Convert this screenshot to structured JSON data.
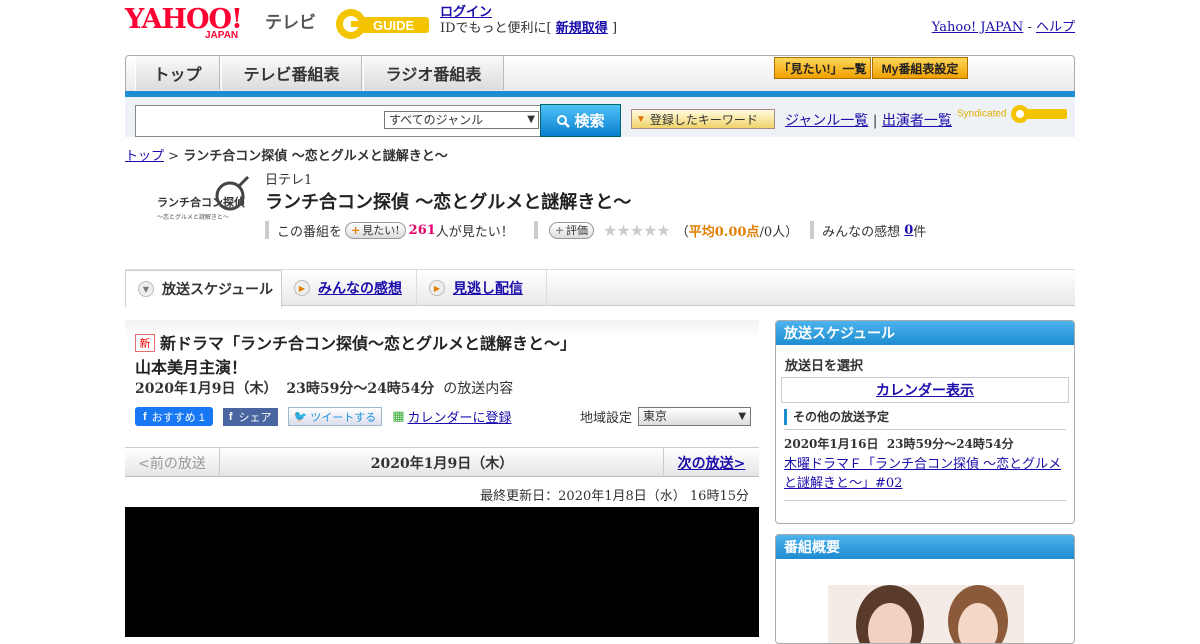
{
  "header": {
    "yahoo_logo": "YAHOO!",
    "yahoo_sub": "JAPAN",
    "tv_label": "テレビ",
    "gguide_logo": "GUIDE",
    "login_link": "ログイン",
    "login_text_pre": "IDでもっと便利に[",
    "signup_link": "新規取得",
    "login_text_post": "]",
    "yahoo_japan_link": "Yahoo! JAPAN",
    "dash": " - ",
    "help_link": "ヘルプ"
  },
  "nav": {
    "tabs": [
      "トップ",
      "テレビ番組表",
      "ラジオ番組表"
    ],
    "mitai_button": "「見たい!」一覧",
    "my_button": "My番組表設定"
  },
  "search": {
    "genre_selected": "すべてのジャンル",
    "search_button": "検索",
    "keyword_button": "登録したキーワード",
    "genre_list_link": "ジャンル一覧",
    "separator": "|",
    "cast_list_link": "出演者一覧",
    "syndicated": "Syndicated"
  },
  "breadcrumb": {
    "top": "トップ",
    "sep": " > ",
    "current": "ランチ合コン探偵 ～恋とグルメと謎解きと～"
  },
  "program": {
    "logo_text": "ランチ合コン探偵",
    "logo_sub": "～恋とグルメと謎解きと～",
    "channel": "日テレ1",
    "title": "ランチ合コン探偵 ～恋とグルメと謎解きと～",
    "want_pre": "この番組を",
    "want_button": "見たい!",
    "want_count": "261",
    "want_post": "人が見たい！",
    "rate_button": "評価",
    "stars": "★★★★★",
    "avg_open": "（",
    "avg": "平均0.00点",
    "avg_post": "/0人）",
    "impressions_label": "みんなの感想",
    "impressions_count": "0",
    "impressions_unit": "件"
  },
  "subtabs": [
    "放送スケジュール",
    "みんなの感想",
    "見逃し配信"
  ],
  "main": {
    "new_badge": "新",
    "news_title_1": "新ドラマ「ランチ合コン探偵～恋とグルメと謎解きと～」",
    "news_title_2": "山本美月主演！",
    "air_date": "2020年1月9日（木）",
    "air_time": "23時59分～24時54分",
    "air_suffix": "の放送内容",
    "fb_recommend": "おすすめ 1",
    "fb_share": "シェア",
    "tweet": "ツイートする",
    "calendar_register": "カレンダーに登録",
    "region_label": "地域設定",
    "region_value": "東京",
    "prev": "<前の放送",
    "pager_date": "2020年1月9日（木）",
    "next": "次の放送>",
    "updated": "最終更新日：2020年1月8日（水） 16時15分"
  },
  "side": {
    "schedule_header": "放送スケジュール",
    "choose_date": "放送日を選択",
    "calendar_button": "カレンダー表示",
    "other_header": "その他の放送予定",
    "other_date": "2020年1月16日",
    "other_time": "23時59分～24時54分",
    "other_link": "木曜ドラマＦ「ランチ合コン探偵 ～恋とグルメと謎解きと～」#02",
    "overview_header": "番組概要"
  },
  "colors": {
    "accent_blue": "#1e8cd0",
    "yahoo_red": "#ff0033",
    "orange": "#f0a000"
  }
}
